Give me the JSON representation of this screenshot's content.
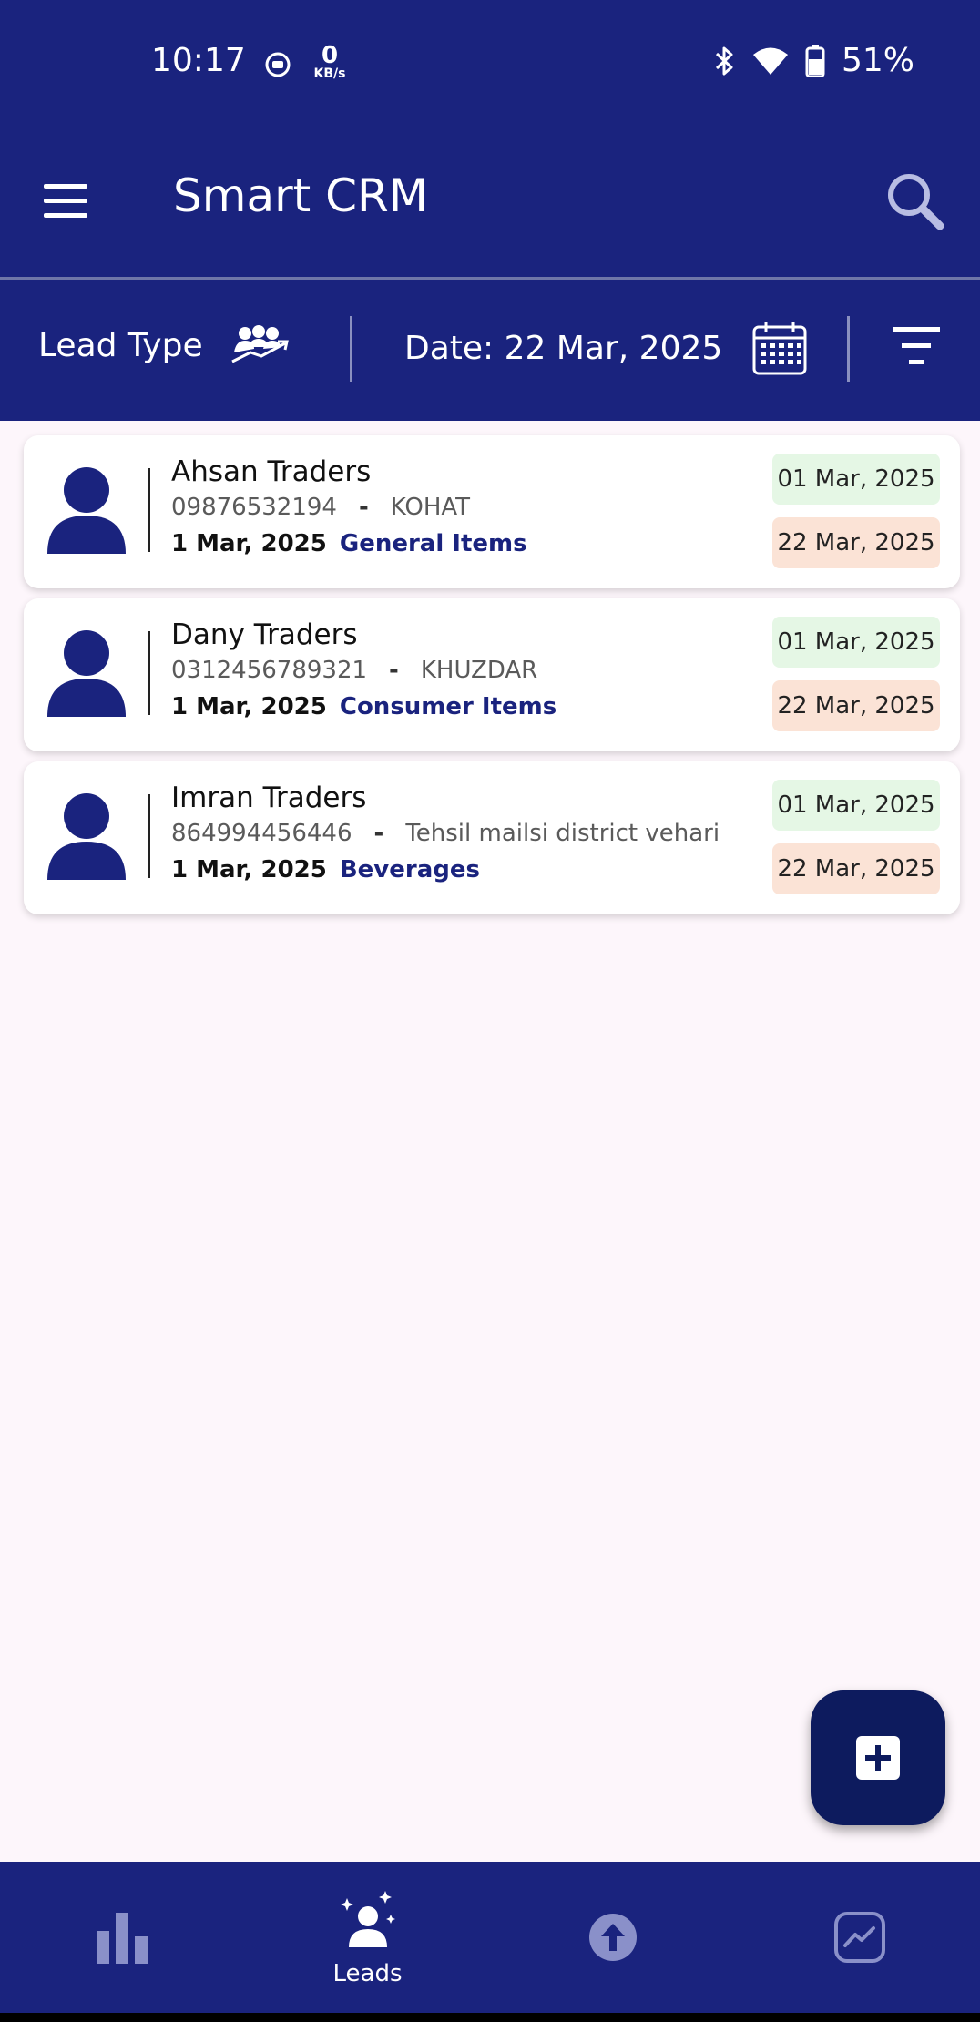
{
  "status_bar": {
    "time": "10:17",
    "net_speed_value": "0",
    "net_speed_unit": "KB/s",
    "battery": "51%",
    "icons": [
      "screen-record-icon",
      "bluetooth-icon",
      "wifi-icon",
      "battery-icon"
    ]
  },
  "app_bar": {
    "title": "Smart CRM",
    "icons": [
      "menu-icon",
      "search-icon"
    ]
  },
  "filters": {
    "lead_type_label": "Lead Type",
    "date_label": "Date: 22 Mar, 2025",
    "icons": [
      "lead-type-icon",
      "calendar-icon",
      "sort-filter-icon"
    ]
  },
  "leads": [
    {
      "name": "Ahsan Traders",
      "phone": "09876532194",
      "separator": "-",
      "location": "KOHAT",
      "date": "1 Mar, 2025",
      "category": "General Items",
      "start_date": "01 Mar, 2025",
      "end_date": "22 Mar, 2025"
    },
    {
      "name": "Dany Traders",
      "phone": "0312456789321",
      "separator": "-",
      "location": "KHUZDAR",
      "date": "1 Mar, 2025",
      "category": "Consumer Items",
      "start_date": "01 Mar, 2025",
      "end_date": "22 Mar, 2025"
    },
    {
      "name": "Imran Traders",
      "phone": "864994456446",
      "separator": "-",
      "location": "Tehsil mailsi district vehari",
      "date": "1 Mar, 2025",
      "category": "Beverages",
      "start_date": "01 Mar, 2025",
      "end_date": "22 Mar, 2025"
    }
  ],
  "fab": {
    "icon": "add-icon"
  },
  "bottom_nav": {
    "items": [
      {
        "icon": "bar-chart-icon",
        "label": ""
      },
      {
        "icon": "leads-icon",
        "label": "Leads",
        "active": true
      },
      {
        "icon": "upload-icon",
        "label": ""
      },
      {
        "icon": "trend-chart-icon",
        "label": ""
      }
    ]
  },
  "colors": {
    "primary": "#1a237e",
    "fab": "#0d1b5e",
    "background": "#fdf6fb",
    "badge_green": "#e5f7e5",
    "badge_peach": "#fbe3d6"
  }
}
